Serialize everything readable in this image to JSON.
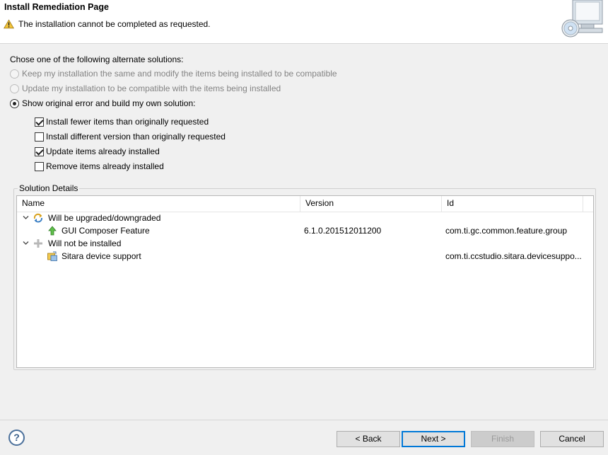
{
  "header": {
    "title": "Install Remediation Page",
    "message": "The installation cannot be completed as requested."
  },
  "options": {
    "label": "Chose one of the following alternate solutions:",
    "radios": [
      {
        "label": "Keep my installation the same and modify the items being installed to be compatible",
        "checked": false,
        "enabled": false
      },
      {
        "label": "Update my installation to be compatible with the items being installed",
        "checked": false,
        "enabled": false
      },
      {
        "label": "Show original error and build my own solution:",
        "checked": true,
        "enabled": true
      }
    ],
    "checkboxes": [
      {
        "label": "Install fewer items than originally requested",
        "checked": true
      },
      {
        "label": "Install different version than originally requested",
        "checked": false
      },
      {
        "label": "Update items already installed",
        "checked": true
      },
      {
        "label": "Remove items already installed",
        "checked": false
      }
    ]
  },
  "details": {
    "label": "Solution Details",
    "columns": [
      "Name",
      "Version",
      "Id"
    ],
    "rows": [
      {
        "name": "Will be upgraded/downgraded",
        "version": "",
        "id": "",
        "icon": "update-icon"
      },
      {
        "name": "GUI Composer Feature",
        "version": "6.1.0.201512011200",
        "id": "com.ti.gc.common.feature.group",
        "icon": "upgrade-arrow-icon"
      },
      {
        "name": "Will not be installed",
        "version": "",
        "id": "",
        "icon": "add-plus-icon"
      },
      {
        "name": "Sitara device support",
        "version": "",
        "id": "com.ti.ccstudio.sitara.devicesuppo...",
        "icon": "feature-icon"
      }
    ]
  },
  "footer": {
    "help": "?",
    "back": "< Back",
    "next": "Next >",
    "finish": "Finish",
    "cancel": "Cancel"
  }
}
